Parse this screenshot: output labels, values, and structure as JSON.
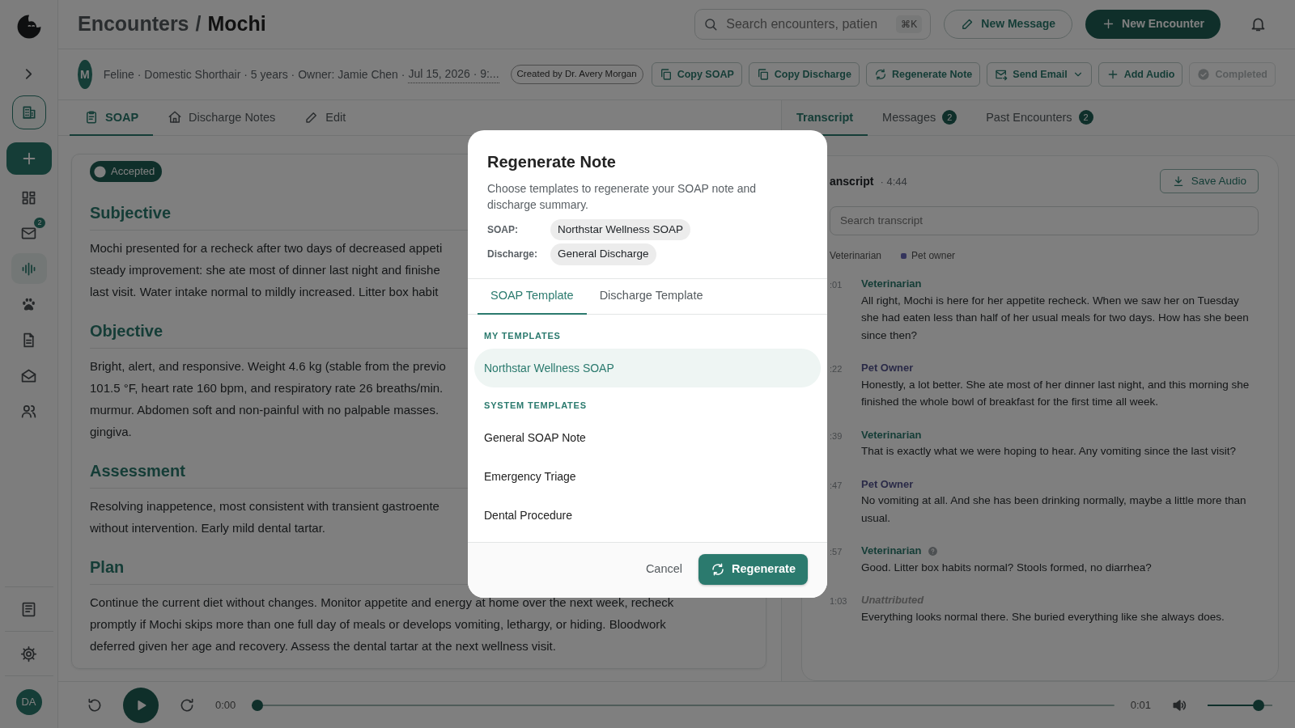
{
  "sidebar": {
    "items": [
      {
        "selected": false
      },
      {
        "selected": false,
        "badge": "2"
      },
      {
        "selected": true
      },
      {
        "selected": false
      },
      {
        "selected": false
      },
      {
        "selected": false
      },
      {
        "selected": false
      }
    ],
    "avatar": "DA"
  },
  "header": {
    "breadcrumb": "Encounters",
    "separator": "/",
    "title": "Mochi",
    "search": {
      "placeholder": "Search encounters, patien",
      "shortcut": "⌘K"
    },
    "buttons": [
      {
        "label": "New Message",
        "kind": "outline"
      },
      {
        "label": "New Encounter",
        "kind": "primary"
      }
    ]
  },
  "patient": {
    "avatar": "M",
    "details": "Feline · Domestic Shorthair · 5 years · Owner: Jamie Chen ·",
    "date": "Jul 15, 2026 · 9:...",
    "created_by": "Created by Dr. Avery Morgan"
  },
  "actions": [
    {
      "label": "Copy SOAP",
      "disabled": false,
      "dropdown": false
    },
    {
      "label": "Copy Discharge",
      "disabled": false,
      "dropdown": false
    },
    {
      "label": "Regenerate Note",
      "disabled": false,
      "dropdown": false
    },
    {
      "label": "Send Email",
      "disabled": false,
      "dropdown": true
    },
    {
      "label": "Add Audio",
      "disabled": false,
      "dropdown": false
    },
    {
      "label": "Completed",
      "disabled": true,
      "dropdown": false
    }
  ],
  "note_tabs": [
    {
      "label": "SOAP",
      "selected": true
    },
    {
      "label": "Discharge Notes",
      "selected": false
    },
    {
      "label": "Edit",
      "selected": false
    }
  ],
  "soap": {
    "status": "Accepted",
    "sections": [
      {
        "heading": "Subjective",
        "lines": [
          "Mochi presented for a recheck after two days of decreased appeti",
          "steady improvement: she ate most of dinner last night and finishe",
          "last visit. Water intake normal to mildly increased. Litter box habit"
        ]
      },
      {
        "heading": "Objective",
        "lines": [
          "Bright, alert, and responsive. Weight 4.6 kg (stable from the previo",
          "101.5 °F, heart rate 160 bpm, and respiratory rate 26 breaths/min.",
          "murmur. Abdomen soft and non-painful with no palpable masses.",
          "gingiva."
        ]
      },
      {
        "heading": "Assessment",
        "lines": [
          "Resolving inappetence, most consistent with transient gastroente",
          "without intervention. Early mild dental tartar."
        ]
      },
      {
        "heading": "Plan",
        "lines": [
          "Continue the current diet without changes. Monitor appetite and energy at home over the next week, recheck",
          "promptly if Mochi skips more than one full day of meals or develops vomiting, lethargy, or hiding. Bloodwork",
          "deferred given her age and recovery. Assess the dental tartar at the next wellness visit."
        ]
      }
    ]
  },
  "side_tabs": [
    {
      "label": "Transcript",
      "selected": true
    },
    {
      "label": "Messages",
      "count": "2",
      "selected": false
    },
    {
      "label": "Past Encounters",
      "count": "2",
      "selected": false
    }
  ],
  "transcript": {
    "title": "anscript",
    "duration": "· 4:44",
    "save_button": "Save Audio",
    "search": {
      "placeholder": "Search transcript"
    },
    "legend": [
      {
        "label": "Veterinarian"
      },
      {
        "label": "Pet owner",
        "color": "#34345c"
      }
    ],
    "entries": [
      {
        "time": ":01",
        "speaker": "Veterinarian",
        "kind": "vet",
        "info": false,
        "text": "All right, Mochi is here for her appetite recheck. When we saw her on Tuesday she had eaten less than half of her usual meals for two days. How has she been since then?"
      },
      {
        "time": ":22",
        "speaker": "Pet Owner",
        "kind": "owner",
        "info": false,
        "text": "Honestly, a lot better. She ate most of her dinner last night, and this morning she finished the whole bowl of breakfast for the first time all week."
      },
      {
        "time": ":39",
        "speaker": "Veterinarian",
        "kind": "vet",
        "info": false,
        "text": "That is exactly what we were hoping to hear. Any vomiting since the last visit?"
      },
      {
        "time": ":47",
        "speaker": "Pet Owner",
        "kind": "owner",
        "info": false,
        "text": "No vomiting at all. And she has been drinking normally, maybe a little more than usual."
      },
      {
        "time": ":57",
        "speaker": "Veterinarian",
        "kind": "vet",
        "info": true,
        "text": "Good. Litter box habits normal? Stools formed, no diarrhea?"
      },
      {
        "time": "1:03",
        "speaker": "Unattributed",
        "kind": "unknown",
        "info": false,
        "text": "Everything looks normal there. She buried everything like she always does."
      }
    ]
  },
  "player": {
    "elapsed": "0:00",
    "total": "0:01",
    "progress": {
      "level": 0
    },
    "volume": {
      "level": 0.85
    }
  },
  "modal": {
    "title": "Regenerate Note",
    "description": "Choose templates to regenerate your SOAP note and discharge summary.",
    "selections": [
      {
        "label": "SOAP:",
        "value": "Northstar Wellness SOAP"
      },
      {
        "label": "Discharge:",
        "value": "General Discharge"
      }
    ],
    "tabs": [
      {
        "label": "SOAP Template",
        "selected": true
      },
      {
        "label": "Discharge Template",
        "selected": false
      }
    ],
    "groups": [
      {
        "heading": "MY TEMPLATES",
        "items": [
          {
            "label": "Northstar Wellness SOAP",
            "selected": true
          }
        ]
      },
      {
        "heading": "SYSTEM TEMPLATES",
        "items": [
          {
            "label": "General SOAP Note",
            "selected": false
          },
          {
            "label": "Emergency Triage",
            "selected": false
          },
          {
            "label": "Dental Procedure",
            "selected": false
          }
        ]
      }
    ],
    "cancel": "Cancel",
    "confirm": "Regenerate"
  }
}
